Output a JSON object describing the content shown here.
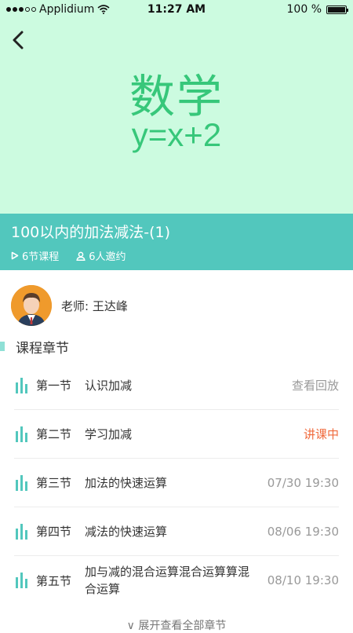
{
  "status_bar": {
    "carrier": "Applidium",
    "time": "11:27 AM",
    "battery_text": "100 %",
    "battery_level": 1.0
  },
  "hero": {
    "subject": "数学",
    "formula": "y=x+2"
  },
  "course": {
    "title": "100以内的加法减法-(1)",
    "lessons": "6节课程",
    "invites": "6人邀约"
  },
  "teacher": {
    "label": "老师: 王达峰"
  },
  "section": {
    "title": "课程章节"
  },
  "chapters": [
    {
      "index": "第一节",
      "name": "认识加减",
      "status": "查看回放"
    },
    {
      "index": "第二节",
      "name": "学习加减",
      "status": "讲课中"
    },
    {
      "index": "第三节",
      "name": "加法的快速运算",
      "status": "07/30 19:30"
    },
    {
      "index": "第四节",
      "name": "减法的快速运算",
      "status": "08/06 19:30"
    },
    {
      "index": "第五节",
      "name": "加与减的混合运算混合运算算混合运算",
      "status": "08/10 19:30"
    }
  ],
  "expand": {
    "label": "∨ 展开查看全部章节"
  },
  "colors": {
    "hero_bg": "#ccfbe0",
    "accent_green": "#37c77a",
    "teal": "#52c7bd",
    "live_orange": "#f06a3c"
  },
  "icons": [
    "back-arrow-icon",
    "play-icon",
    "person-icon",
    "bars-icon",
    "wifi-icon"
  ]
}
